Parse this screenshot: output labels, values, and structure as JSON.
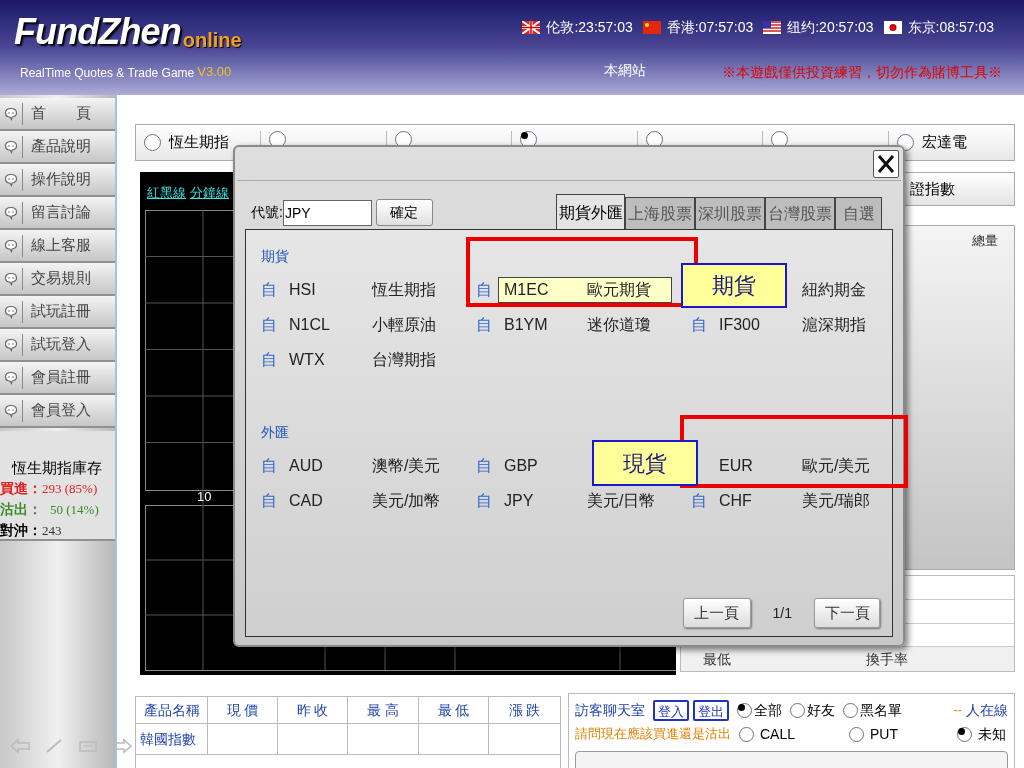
{
  "header": {
    "logo": "FundZhen",
    "logo_suffix": "online",
    "tagline": "RealTime Quotes & Trade Game",
    "version": "V3.00",
    "clocks": [
      {
        "kind": "uk",
        "label": "伦敦:23:57:03"
      },
      {
        "kind": "cn",
        "label": "香港:07:57:03"
      },
      {
        "kind": "us",
        "label": "纽约:20:57:03"
      },
      {
        "kind": "jp",
        "label": "东京:08:57:03"
      }
    ],
    "site_link": "本網站",
    "notice": "※本遊戲僅供投資練習，切勿作為賭博工具※"
  },
  "sidebar": {
    "items": [
      "首　　頁",
      "產品說明",
      "操作說明",
      "留言討論",
      "線上客服",
      "交易規則",
      "試玩註冊",
      "試玩登入",
      "會員註冊",
      "會員登入"
    ],
    "inventory": {
      "title": "恆生期指庫存",
      "rows": [
        {
          "kind": "buy",
          "label": "買進：",
          "value": "293 (85%)"
        },
        {
          "kind": "sell",
          "label": "沽出：",
          "value": "50 (14%)"
        },
        {
          "kind": "hedge",
          "label": "對沖：",
          "value": "243"
        }
      ]
    }
  },
  "market_tabs": [
    {
      "label": "恆生期指",
      "selected": false
    },
    {
      "selected": false
    },
    {
      "selected": false
    },
    {
      "selected": true
    },
    {
      "selected": false
    },
    {
      "selected": false
    },
    {
      "label": "宏達電",
      "selected": false
    }
  ],
  "chart": {
    "links": [
      "紅黑線",
      "分鐘線"
    ],
    "axis_label": "10"
  },
  "quote_panel": {
    "header": "證指數",
    "column": "總量",
    "footer": [
      "最低",
      "換手率"
    ]
  },
  "dialog": {
    "code_label": "代號:",
    "code_value": "JPY",
    "confirm": "確定",
    "tabs": [
      {
        "label": "期貨外匯",
        "selected": true
      },
      {
        "label": "上海股票",
        "selected": false
      },
      {
        "label": "深圳股票",
        "selected": false
      },
      {
        "label": "台灣股票",
        "selected": false
      },
      {
        "label": "自選",
        "selected": false
      }
    ],
    "sections": [
      {
        "title": "期貨",
        "items": [
          {
            "mark": "自",
            "code": "HSI",
            "name": "恆生期指",
            "selected": false
          },
          {
            "mark": "自",
            "code": "M1EC",
            "name": "歐元期貨",
            "selected": true
          },
          {
            "name": "紐約期金",
            "selected": false
          },
          {
            "mark": "自",
            "code": "N1CL",
            "name": "小輕原油",
            "selected": false
          },
          {
            "mark": "自",
            "code": "B1YM",
            "name": "迷你道瓊",
            "selected": false
          },
          {
            "mark": "自",
            "code": "IF300",
            "name": "滬深期指",
            "selected": false
          },
          {
            "mark": "自",
            "code": "WTX",
            "name": "台灣期指",
            "selected": false
          }
        ]
      },
      {
        "title": "外匯",
        "items": [
          {
            "mark": "自",
            "code": "AUD",
            "name": "澳幣/美元",
            "selected": false
          },
          {
            "mark": "自",
            "code": "GBP",
            "selected": false
          },
          {
            "code": "EUR",
            "name": "歐元/美元",
            "selected": false
          },
          {
            "mark": "自",
            "code": "CAD",
            "name": "美元/加幣",
            "selected": false
          },
          {
            "mark": "自",
            "code": "JPY",
            "name": "美元/日幣",
            "selected": false
          },
          {
            "mark": "自",
            "code": "CHF",
            "name": "美元/瑞郎",
            "selected": false
          }
        ]
      }
    ],
    "pager": {
      "prev": "上一頁",
      "page": "1/1",
      "next": "下一頁"
    }
  },
  "annotations": [
    {
      "kind": "frame"
    },
    {
      "kind": "frame"
    },
    {
      "kind": "callout",
      "label": "期貨"
    },
    {
      "kind": "callout",
      "label": "現貨"
    }
  ],
  "product_table": {
    "columns": [
      "產品名稱",
      "現 價",
      "昨 收",
      "最 高",
      "最 低",
      "漲 跌"
    ],
    "rows": [
      [
        "韓國指數"
      ]
    ]
  },
  "chat": {
    "title": "訪客聊天室",
    "buttons": [
      "登入",
      "登出"
    ],
    "filters": [
      {
        "label": "全部",
        "selected": true
      },
      {
        "label": "好友",
        "selected": false
      },
      {
        "label": "黑名單",
        "selected": false
      }
    ],
    "online_count": "--",
    "online_label": "人在線",
    "question": "請問現在應該買進還是沽出",
    "votes": [
      {
        "label": "CALL",
        "selected": false
      },
      {
        "label": "PUT",
        "selected": false
      },
      {
        "label": "未知",
        "selected": true
      }
    ]
  }
}
